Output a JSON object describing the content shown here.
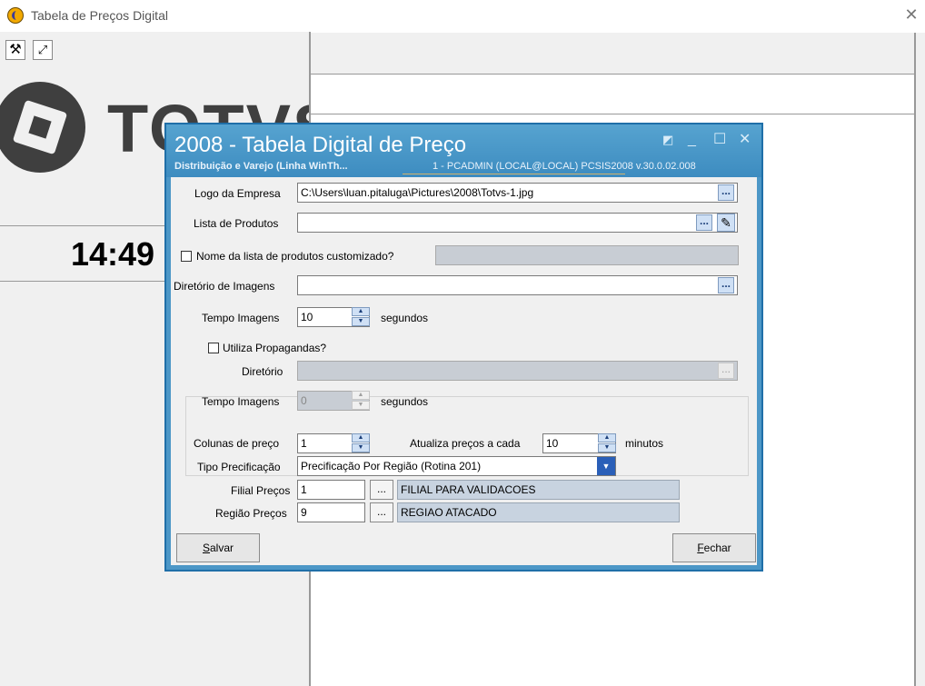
{
  "window": {
    "title": "Tabela de Preços Digital"
  },
  "left": {
    "logo_text": "TOTVS",
    "clock": "14:49"
  },
  "dialog": {
    "title": "2008 - Tabela Digital de Preço",
    "subtitle": "Distribuição e Varejo (Linha WinTh...",
    "info": "1 - PCADMIN (LOCAL@LOCAL)   PCSIS2008  v.30.0.02.008",
    "logo_label": "Logo da Empresa",
    "logo_value": "C:\\Users\\luan.pitaluga\\Pictures\\2008\\Totvs-1.jpg",
    "produtos_label": "Lista de Produtos",
    "produtos_value": "",
    "custom_label": "Nome da lista de produtos customizado?",
    "dir_label": "Diretório de Imagens",
    "dir_value": "",
    "tempo_label": "Tempo Imagens",
    "tempo_value": "10",
    "segundos": "segundos",
    "prop_label": "Utiliza Propagandas?",
    "prop_dir_label": "Diretório",
    "prop_tempo_label": "Tempo Imagens",
    "prop_tempo_value": "0",
    "prop_segundos": "segundos",
    "colunas_label": "Colunas de preço",
    "colunas_value": "1",
    "atualiza_label": "Atualiza preços a cada",
    "atualiza_value": "10",
    "minutos": "minutos",
    "tipo_label": "Tipo Precificação",
    "tipo_value": "Precificação Por Região (Rotina 201)",
    "filial_label": "Filial Preços",
    "filial_value": "1",
    "filial_desc": "FILIAL PARA VALIDACOES",
    "regiao_label": "Região Preços",
    "regiao_value": "9",
    "regiao_desc": "REGIAO ATACADO",
    "ellipsis": "...",
    "salvar_first": "S",
    "salvar_rest": "alvar",
    "fechar_first": "F",
    "fechar_rest": "echar"
  }
}
